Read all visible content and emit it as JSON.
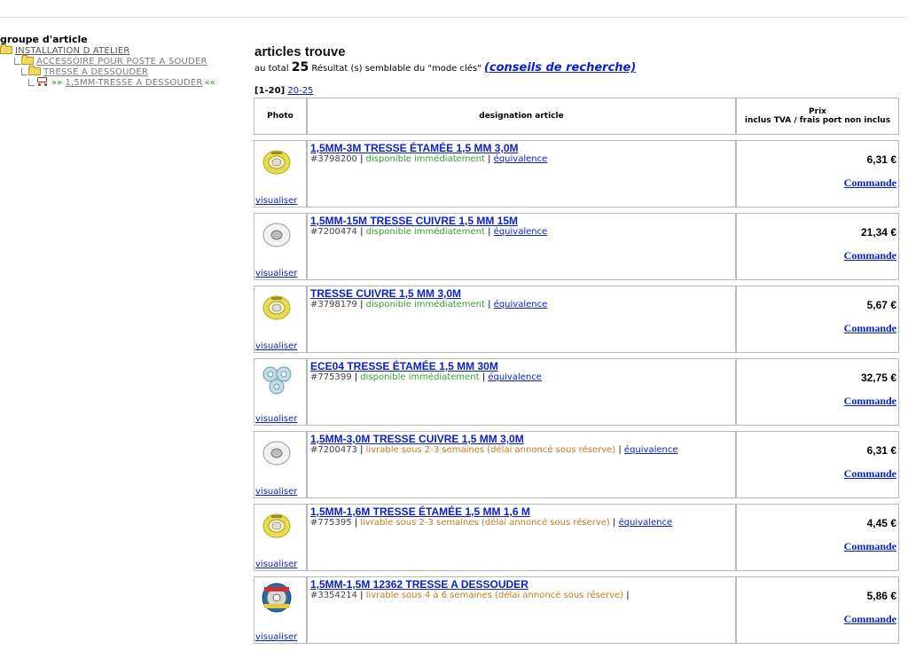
{
  "tree": {
    "title": "groupe d'article",
    "items": [
      {
        "label": "INSTALLATION D ATELIER"
      },
      {
        "label": "ACCESSOIRE POUR POSTE A SOUDER"
      },
      {
        "label": "TRESSE A DESSOUDER"
      },
      {
        "prefix": "»»",
        "label": "1,5MM-TRESSE A DESSOUDER",
        "suffix": "««"
      }
    ]
  },
  "main": {
    "title": "articles trouve",
    "summary_prefix": "au total",
    "count": "25",
    "summary_mid": "Résultat (s) semblable du \"mode clés\"",
    "tips_link": "(conseils de recherche)"
  },
  "pager": {
    "current": "[1-20]",
    "next": "20-25"
  },
  "table": {
    "headers": {
      "photo": "Photo",
      "designation": "designation article",
      "price_line1": "Prix",
      "price_line2": "inclus TVA / frais port non inclus"
    },
    "visualize_label": "visualiser",
    "order_label": "Commande",
    "rows": [
      {
        "title": "1,5MM-3M TRESSE ÉTAMÉE 1,5 MM 3,0M",
        "ref": "#3798200",
        "avail": "disponible immédiatement",
        "equiv": "équivalence",
        "price": "6,31 €",
        "status": "green",
        "thumb": "yellow"
      },
      {
        "title": "1,5MM-15M TRESSE CUIVRE 1,5 MM 15M",
        "ref": "#7200474",
        "avail": "disponible immédiatement",
        "equiv": "équivalence",
        "price": "21,34 €",
        "status": "green",
        "thumb": "white"
      },
      {
        "title": "TRESSE CUIVRE 1,5 MM 3,0M",
        "ref": "#3798179",
        "avail": "disponible immédiatement",
        "equiv": "équivalence",
        "price": "5,67 €",
        "status": "green",
        "thumb": "yellow"
      },
      {
        "title": "ECE04 TRESSE ÉTAMÉE 1,5 MM 30M",
        "ref": "#775399",
        "avail": "disponible immédiatement",
        "equiv": "équivalence",
        "price": "32,75 €",
        "status": "green",
        "thumb": "blue"
      },
      {
        "title": "1,5MM-3,0M TRESSE CUIVRE 1,5 MM 3,0M",
        "ref": "#7200473",
        "avail": "livrable sous 2-3 semaines (délai annoncé sous réserve)",
        "equiv": "équivalence",
        "price": "6,31 €",
        "status": "orange",
        "thumb": "white"
      },
      {
        "title": "1,5MM-1,6M TRESSE ÉTAMÉE 1,5 MM 1,6 M",
        "ref": "#775395",
        "avail": "livrable sous 2-3 semaines (délai annoncé sous réserve)",
        "equiv": "équivalence",
        "price": "4,45 €",
        "status": "orange",
        "thumb": "yellow"
      },
      {
        "title": "1,5MM-1,5M 12362 TRESSE A DESSOUDER",
        "ref": "#3354214",
        "avail": "livrable sous 4 à 6 semaines (délai annoncé sous réserve)",
        "equiv": "",
        "price": "5,86 €",
        "status": "orange",
        "thumb": "badge"
      }
    ]
  },
  "colors": {
    "link": "#0b21c8",
    "available": "#37a02c",
    "delayed": "#c37a1a",
    "border": "#b9b9b9"
  }
}
